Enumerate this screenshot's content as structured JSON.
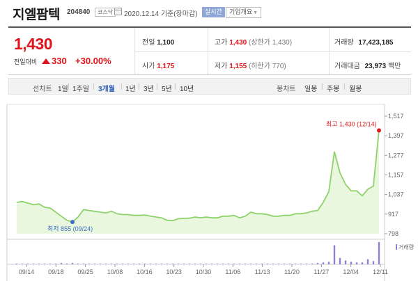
{
  "header": {
    "stock_name": "지엘팜텍",
    "stock_code": "204840",
    "market": "코스닥",
    "date": "2020.12.14 기준(장마감)",
    "realtime_label": "실시간",
    "company_label": "기업개요",
    "company_caret": "▼"
  },
  "quote": {
    "price": "1,430",
    "change_label": "전일대비",
    "change_value": "330",
    "change_pct": "+30.00%",
    "prev_close_label": "전일",
    "prev_close": "1,100",
    "open_label": "시가",
    "open": "1,175",
    "high_label": "고가",
    "high": "1,430",
    "high_limit": "(상한가 1,430)",
    "low_label": "저가",
    "low": "1,155",
    "low_limit": "(하한가 770)",
    "volume_label": "거래량",
    "volume": "17,423,185",
    "amount_label": "거래대금",
    "amount": "23,973",
    "amount_unit": "백만",
    "up_color": "#e0141a"
  },
  "tabs": {
    "line_label": "선차트",
    "line_periods": [
      "1일",
      "1주일",
      "3개월",
      "1년",
      "3년",
      "5년",
      "10년"
    ],
    "active_period": "3개월",
    "candle_label": "봉차트",
    "candle_periods": [
      "일봉",
      "주봉",
      "월봉"
    ]
  },
  "chart_data": {
    "type": "area",
    "y_ticks": [
      "1,517",
      "1,397",
      "1,277",
      "1,157",
      "1,037",
      "917",
      "798"
    ],
    "ylim": [
      798,
      1517
    ],
    "x_labels": [
      "09/14",
      "09/18",
      "09/25",
      "10/08",
      "10/16",
      "10/23",
      "10/30",
      "11/06",
      "11/13",
      "11/20",
      "11/27",
      "12/04",
      "12/11"
    ],
    "max_label": "최고 1,430 (12/14)",
    "min_label": "최저 855 (09/24)",
    "volume_legend": "거래량",
    "line_color": "#8ed26b",
    "fill_color": "#eaf7df",
    "series": [
      {
        "values": [
          990,
          995,
          985,
          975,
          980,
          960,
          955,
          930,
          905,
          880,
          870,
          900,
          945,
          940,
          935,
          930,
          925,
          935,
          920,
          915,
          915,
          910,
          910,
          912,
          905,
          900,
          895,
          880,
          878,
          890,
          892,
          893,
          900,
          895,
          900,
          895,
          895,
          905,
          905,
          910,
          895,
          905,
          930,
          920,
          920,
          915,
          905,
          905,
          910,
          910,
          920,
          920,
          925,
          935,
          940,
          990,
          1055,
          1300,
          1170,
          1100,
          1060,
          1060,
          1030,
          1070,
          1090,
          1430
        ]
      },
      {
        "name": "거래량",
        "values": [
          1,
          1,
          1,
          1,
          1,
          1,
          1,
          1,
          2,
          1,
          2,
          1,
          1,
          1,
          1,
          1,
          1,
          1,
          1,
          1,
          1,
          1,
          1,
          1,
          1,
          1,
          1,
          1,
          1,
          1,
          1,
          1,
          1,
          1,
          1,
          1,
          1,
          1,
          1,
          1,
          1,
          1,
          1,
          1,
          1,
          1,
          1,
          1,
          1,
          1,
          1,
          1,
          1,
          1,
          2,
          3,
          4,
          30,
          10,
          6,
          4,
          3,
          3,
          8,
          5,
          35
        ]
      }
    ]
  }
}
